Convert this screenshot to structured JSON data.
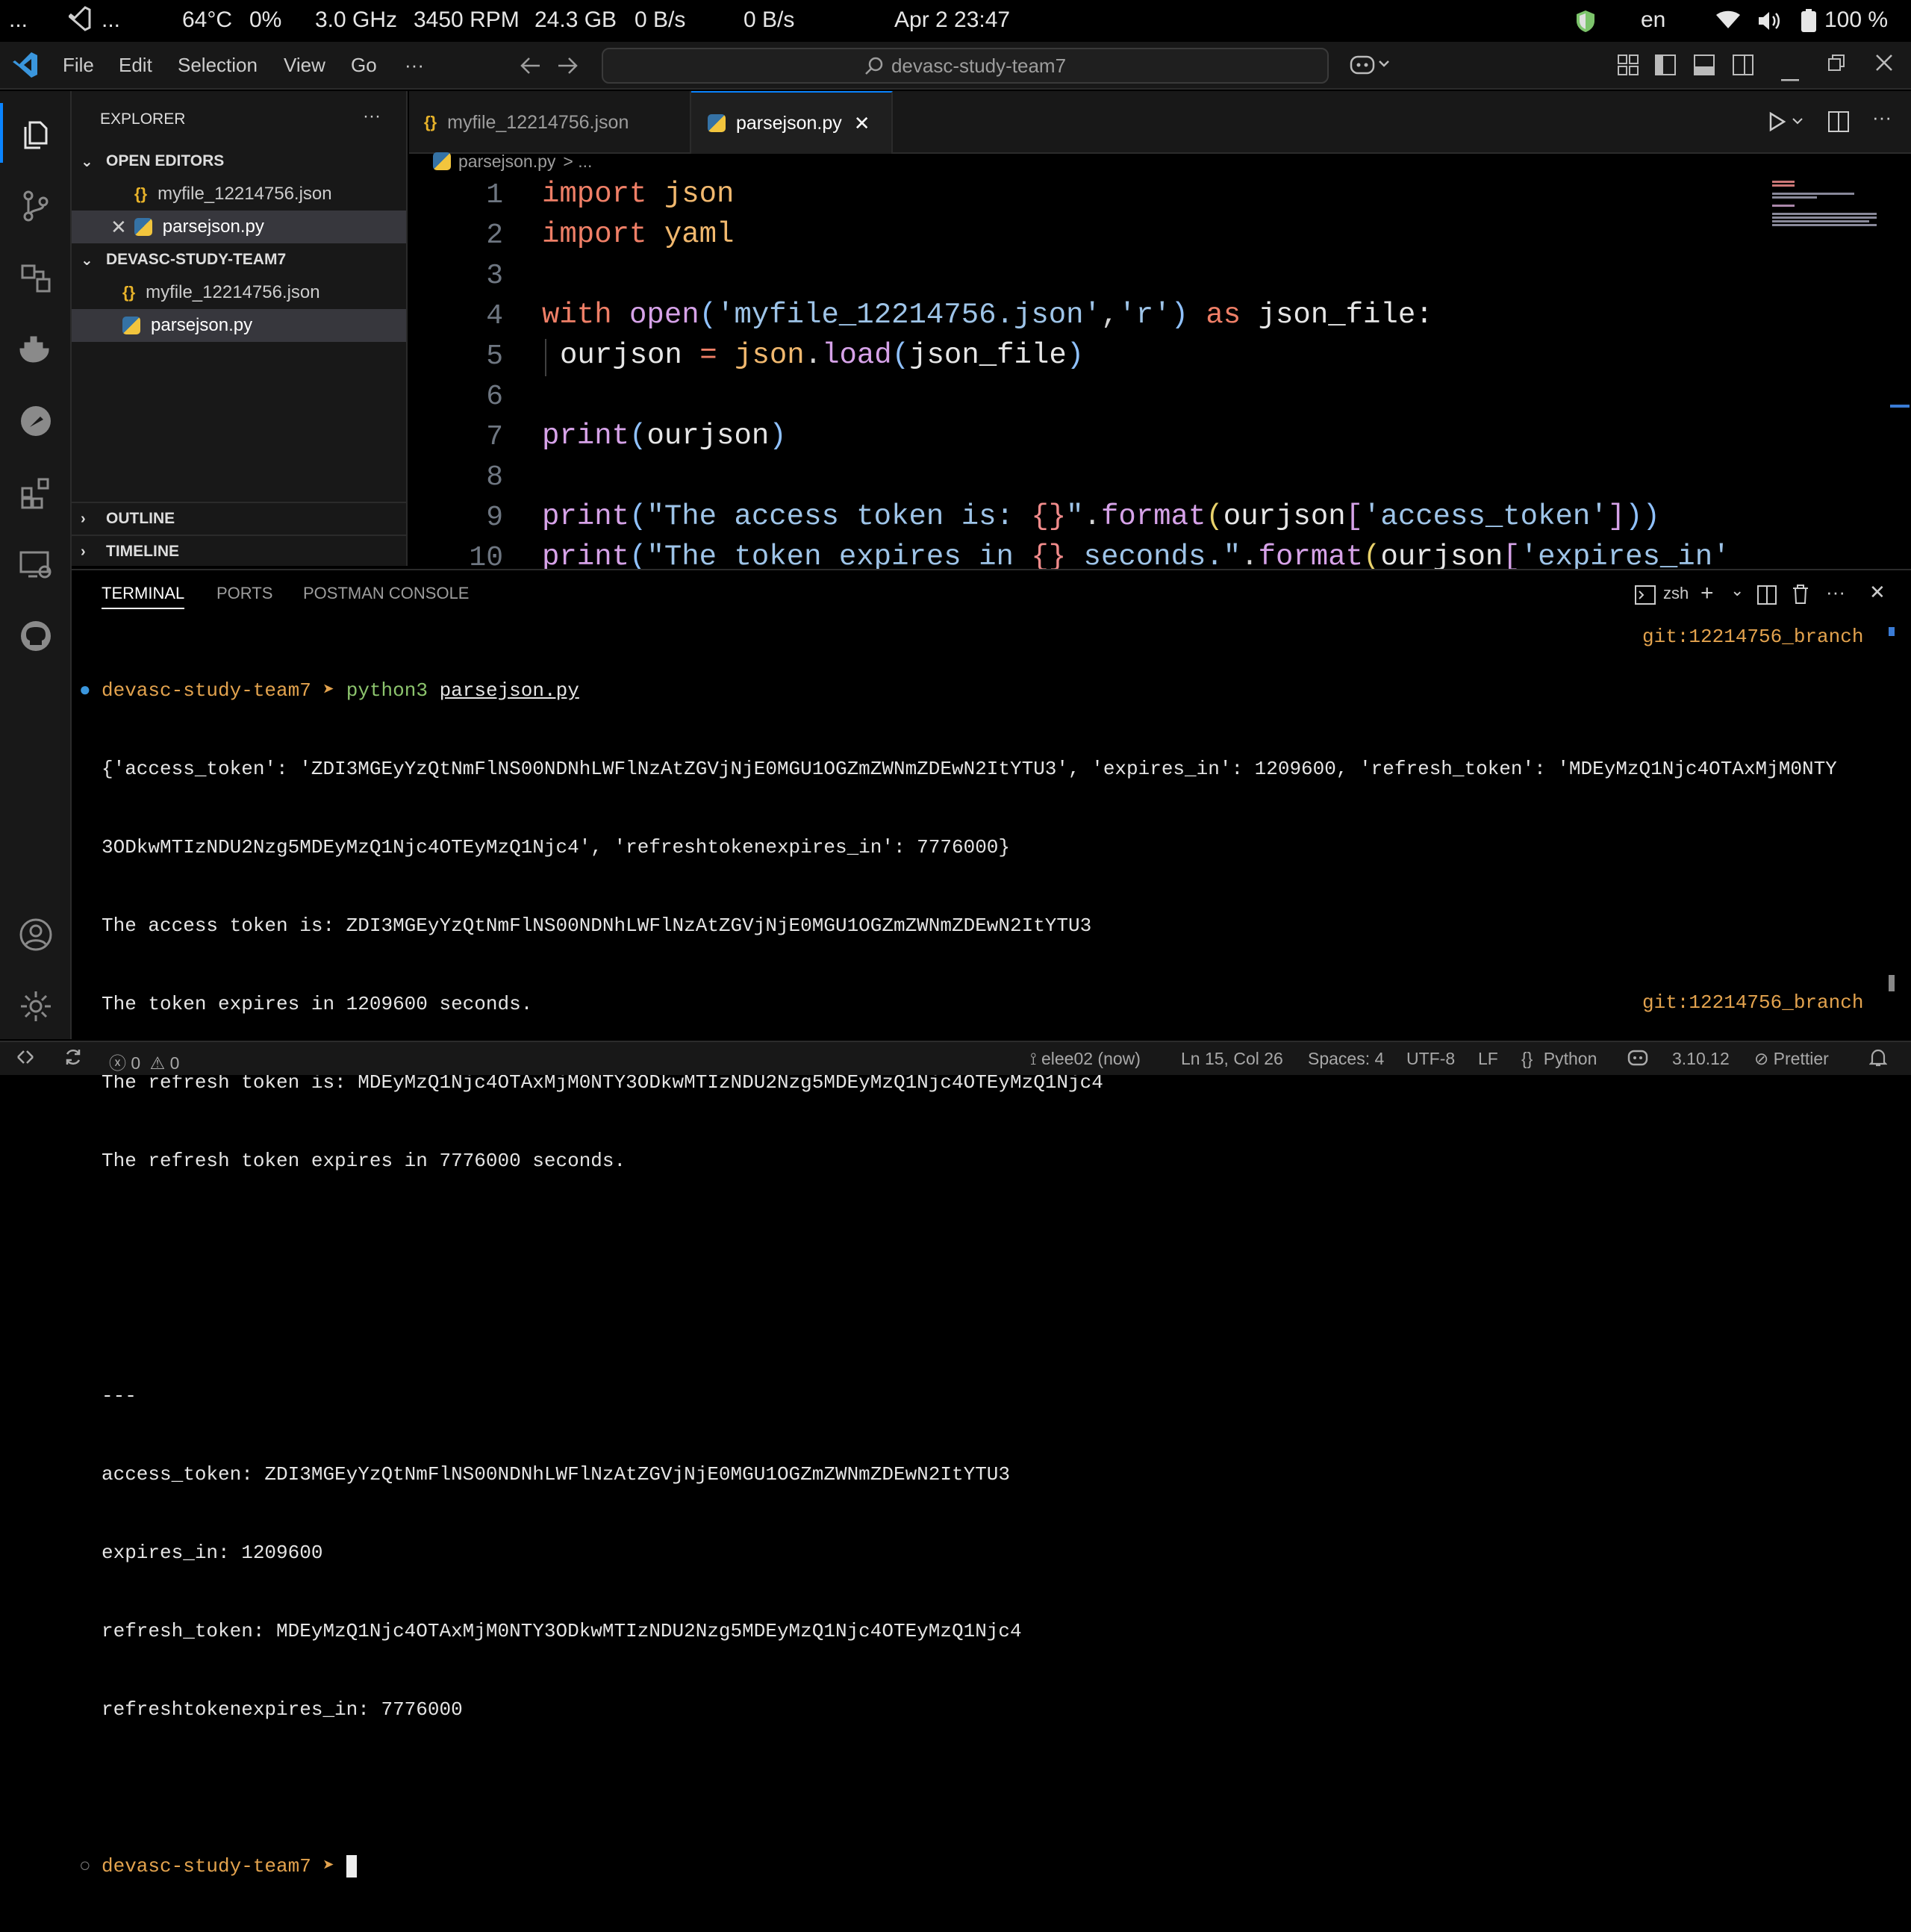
{
  "system": {
    "menu_dots": "...",
    "app_dots": "...",
    "temp": "64°C",
    "cpu": "0%",
    "freq": "3.0 GHz",
    "fan": "3450 RPM",
    "mem": "24.3 GB",
    "net_up": "0 B/s",
    "net_down": "0 B/s",
    "clock": "Apr 2  23:47",
    "lang": "en",
    "battery": "100 %"
  },
  "menu": {
    "file": "File",
    "edit": "Edit",
    "selection": "Selection",
    "view": "View",
    "go": "Go",
    "more": "···"
  },
  "command_center": "devasc-study-team7",
  "sidebar": {
    "title": "EXPLORER",
    "more": "···",
    "open_editors": "OPEN EDITORS",
    "open_files": [
      {
        "name": "myfile_12214756.json"
      },
      {
        "name": "parsejson.py"
      }
    ],
    "folder": "DEVASC-STUDY-TEAM7",
    "folder_files": [
      {
        "name": "myfile_12214756.json"
      },
      {
        "name": "parsejson.py"
      }
    ],
    "outline": "OUTLINE",
    "timeline": "TIMELINE"
  },
  "tabs": [
    {
      "label": "myfile_12214756.json"
    },
    {
      "label": "parsejson.py"
    }
  ],
  "breadcrumb": {
    "file": "parsejson.py",
    "rest": "> ..."
  },
  "editor": {
    "line_numbers": [
      "1",
      "2",
      "3",
      "4",
      "5",
      "6",
      "7",
      "8",
      "9",
      "10"
    ],
    "l1": {
      "kw": "import",
      "mod": "json"
    },
    "l2": {
      "kw": "import",
      "mod": "yaml"
    },
    "l4": {
      "kw": "with",
      "fn": "open",
      "p1": "(",
      "s1": "'myfile_12214756.json'",
      "comma": ",",
      "s2": "'r'",
      "p2": ")",
      "as": "as",
      "var": "json_file:"
    },
    "l5": {
      "var": "ourjson",
      "eq": " = ",
      "mod": "json",
      "dot": ".",
      "fn": "load",
      "p1": "(",
      "arg": "json_file",
      "p2": ")"
    },
    "l7": {
      "fn": "print",
      "p1": "(",
      "arg": "ourjson",
      "p2": ")"
    },
    "l9": {
      "fn": "print",
      "p1": "(",
      "s1": "\"The access token is: ",
      "braces": "{}",
      "s2": "\"",
      "dot": ".",
      "fn2": "format",
      "p2": "(",
      "arg": "ourjson",
      "b1": "[",
      "key": "'access_token'",
      "b2": "]",
      "p3": "))"
    },
    "l10": {
      "fn": "print",
      "p1": "(",
      "s1": "\"The token expires in ",
      "braces": "{}",
      "s2": " seconds.\"",
      "dot": ".",
      "fn2": "format",
      "p2": "(",
      "arg": "ourjson",
      "b1": "[",
      "key": "'expires_in'",
      "b2": "]"
    }
  },
  "panel": {
    "tabs": [
      "TERMINAL",
      "PORTS",
      "POSTMAN CONSOLE"
    ],
    "shell": "zsh"
  },
  "terminal": {
    "prompt_dir": "devasc-study-team7",
    "prompt_arrow": "➤",
    "cmd": "python3",
    "cmd_arg": "parsejson.py",
    "git": "git:12214756_branch",
    "lines": [
      "{'access_token': 'ZDI3MGEyYzQtNmFlNS00NDNhLWFlNzAtZGVjNjE0MGU1OGZmZWNmZDEwN2ItYTU3', 'expires_in': 1209600, 'refresh_token': 'MDEyMzQ1Njc4OTAxMjM0NTY",
      "3ODkwMTIzNDU2Nzg5MDEyMzQ1Njc4OTEyMzQ1Njc4', 'refreshtokenexpires_in': 7776000}",
      "The access token is: ZDI3MGEyYzQtNmFlNS00NDNhLWFlNzAtZGVjNjE0MGU1OGZmZWNmZDEwN2ItYTU3",
      "The token expires in 1209600 seconds.",
      "The refresh token is: MDEyMzQ1Njc4OTAxMjM0NTY3ODkwMTIzNDU2Nzg5MDEyMzQ1Njc4OTEyMzQ1Njc4",
      "The refresh token expires in 7776000 seconds.",
      "",
      "",
      "---",
      "access_token: ZDI3MGEyYzQtNmFlNS00NDNhLWFlNzAtZGVjNjE0MGU1OGZmZWNmZDEwN2ItYTU3",
      "expires_in: 1209600",
      "refresh_token: MDEyMzQ1Njc4OTAxMjM0NTY3ODkwMTIzNDU2Nzg5MDEyMzQ1Njc4OTEyMzQ1Njc4",
      "refreshtokenexpires_in: 7776000"
    ]
  },
  "status": {
    "errors": "0",
    "warnings": "0",
    "blame": "elee02 (now)",
    "position": "Ln 15, Col 26",
    "spaces": "Spaces: 4",
    "encoding": "UTF-8",
    "eol": "LF",
    "lang_braces": "{}",
    "language": "Python",
    "version": "3.10.12",
    "prettier": "Prettier"
  },
  "colors": {
    "accent": "#0a84ff",
    "prompt": "#e3a34e",
    "cmd": "#8cc46d"
  }
}
